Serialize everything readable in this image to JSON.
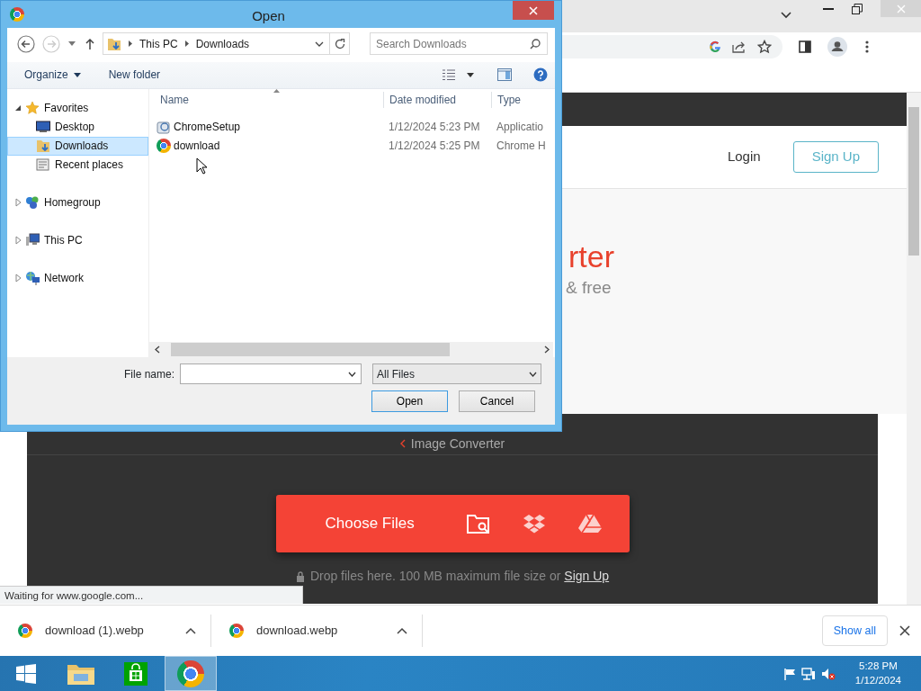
{
  "browser": {
    "site_nav": {
      "login": "Login",
      "signup": "Sign Up"
    },
    "hero": {
      "title": "rter",
      "subtitle": "& free"
    },
    "upload": {
      "breadcrumb": "Image Converter",
      "button": "Choose Files",
      "drop_text": "Drop files here. 100 MB maximum file size or",
      "drop_link": "Sign Up"
    },
    "status": "Waiting for www.google.com...",
    "downloads": [
      {
        "name": "download (1).webp"
      },
      {
        "name": "download.webp"
      }
    ],
    "show_all": "Show all"
  },
  "dialog": {
    "title": "Open",
    "path": [
      "This PC",
      "Downloads"
    ],
    "search": {
      "placeholder": "Search Downloads"
    },
    "toolbar": {
      "organize": "Organize",
      "new_folder": "New folder"
    },
    "tree": [
      {
        "label": "Favorites",
        "kind": "favorites",
        "expanded": true,
        "selected": false,
        "children": [
          {
            "label": "Desktop",
            "kind": "desktop",
            "selected": false
          },
          {
            "label": "Downloads",
            "kind": "downloads",
            "selected": true
          },
          {
            "label": "Recent places",
            "kind": "recent",
            "selected": false
          }
        ]
      },
      {
        "label": "Homegroup",
        "kind": "homegroup",
        "expanded": false,
        "selected": false
      },
      {
        "label": "This PC",
        "kind": "pc",
        "expanded": false,
        "selected": false
      },
      {
        "label": "Network",
        "kind": "network",
        "expanded": false,
        "selected": false
      }
    ],
    "columns": [
      "Name",
      "Date modified",
      "Type"
    ],
    "rows": [
      {
        "kind": "setup",
        "name": "ChromeSetup",
        "date": "1/12/2024 5:23 PM",
        "type": "Applicatio"
      },
      {
        "kind": "browser",
        "name": "download",
        "date": "1/12/2024 5:25 PM",
        "type": "Chrome H"
      }
    ],
    "file_name_label": "File name:",
    "filter": "All Files",
    "buttons": [
      "Open",
      "Cancel"
    ]
  },
  "taskbar": {
    "apps": [
      {
        "kind": "start",
        "selected": false
      },
      {
        "kind": "explorer",
        "selected": false
      },
      {
        "kind": "store",
        "selected": false
      },
      {
        "kind": "browser",
        "selected": true
      }
    ],
    "time": "5:28 PM",
    "date": "1/12/2024"
  }
}
